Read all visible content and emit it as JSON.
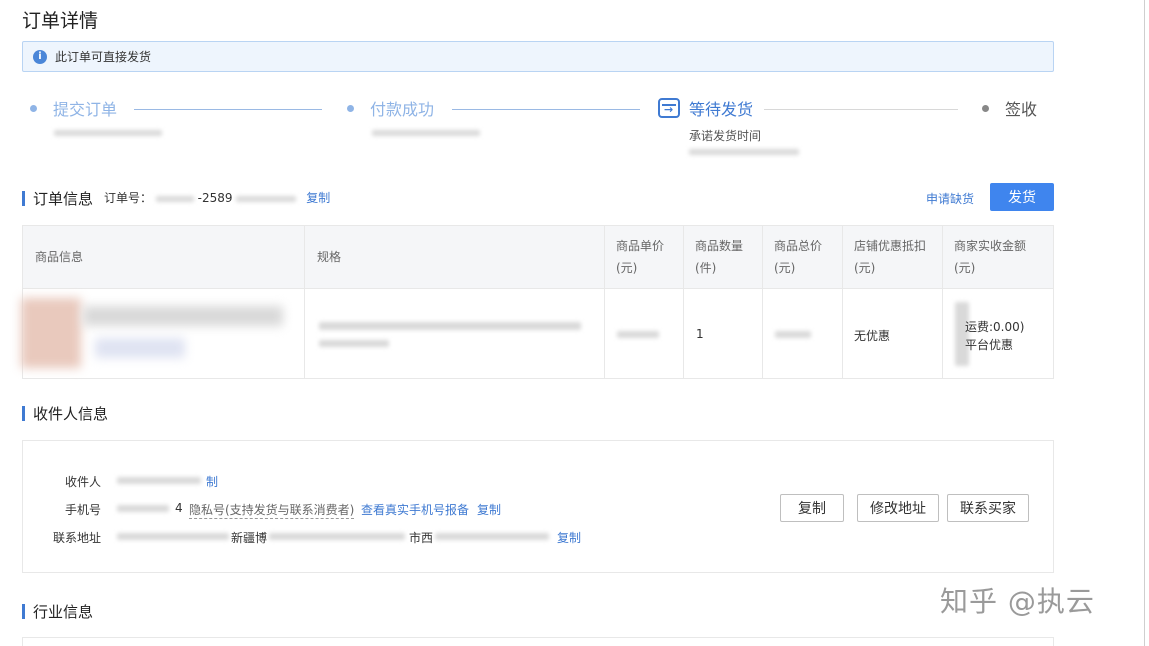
{
  "page": {
    "title": "订单详情"
  },
  "notice": {
    "icon": "info-icon",
    "text": "此订单可直接发货"
  },
  "steps": [
    {
      "label": "提交订单"
    },
    {
      "label": "付款成功"
    },
    {
      "label": "等待发货",
      "sub": "承诺发货时间"
    },
    {
      "label": "签收"
    }
  ],
  "order": {
    "section_title": "订单信息",
    "order_no_label": "订单号：",
    "order_no_visible": "-2589",
    "copy": "复制",
    "apply_shortage": "申请缺货",
    "ship_button": "发货"
  },
  "table": {
    "headers": [
      {
        "l1": "商品信息",
        "l2": ""
      },
      {
        "l1": "规格",
        "l2": ""
      },
      {
        "l1": "商品单价",
        "l2": "(元)"
      },
      {
        "l1": "商品数量",
        "l2": "(件)"
      },
      {
        "l1": "商品总价",
        "l2": "(元)"
      },
      {
        "l1": "店铺优惠抵扣",
        "l2": "(元)"
      },
      {
        "l1": "商家实收金额",
        "l2": "(元)"
      }
    ],
    "row": {
      "quantity": "1",
      "shop_discount": "无优惠",
      "shipping": "运费:0.00)",
      "platform_discount": "平台优惠"
    }
  },
  "receiver": {
    "section_title": "收件人信息",
    "name_label": "收件人",
    "name_copy": "制",
    "phone_label": "手机号",
    "phone_visible": "4",
    "phone_privacy": "隐私号(支持发货与联系消费者)",
    "phone_real": "查看真实手机号报备",
    "phone_copy": "复制",
    "address_label": "联系地址",
    "address_visible_1": "新疆博",
    "address_visible_2": "市西",
    "address_copy": "复制",
    "btn_copy": "复制",
    "btn_edit_address": "修改地址",
    "btn_contact_buyer": "联系买家"
  },
  "industry": {
    "section_title": "行业信息"
  },
  "watermark": "知乎 @执云"
}
